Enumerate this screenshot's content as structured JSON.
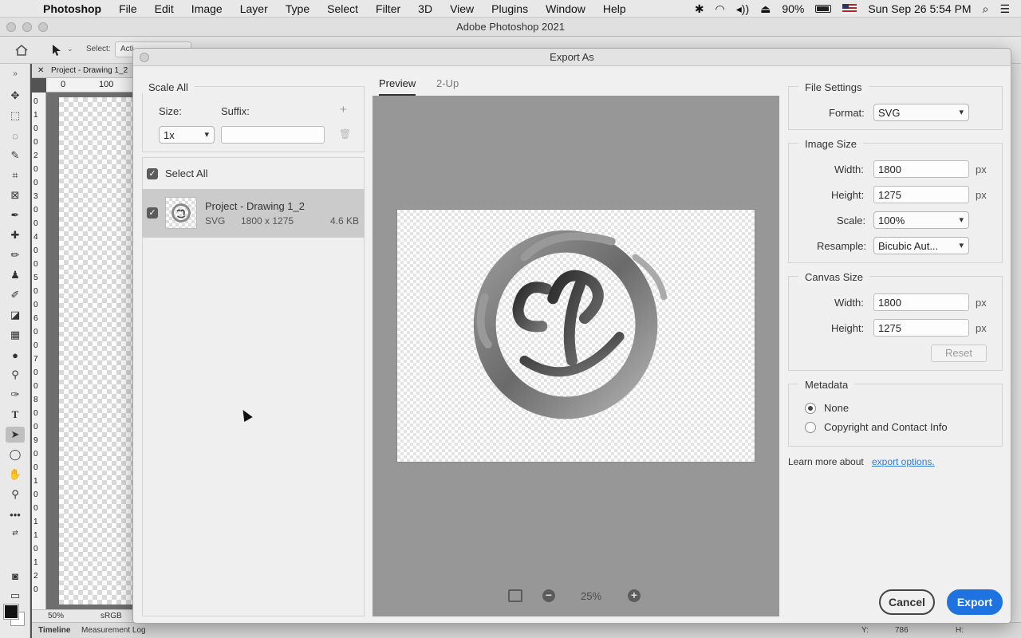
{
  "menubar": {
    "app": "Photoshop",
    "items": [
      "File",
      "Edit",
      "Image",
      "Layer",
      "Type",
      "Select",
      "Filter",
      "3D",
      "View",
      "Plugins",
      "Window",
      "Help"
    ],
    "battery": "90%",
    "datetime": "Sun Sep 26  5:54 PM"
  },
  "window": {
    "title": "Adobe Photoshop 2021"
  },
  "options": {
    "select_label": "Select:",
    "select_value": "Acti"
  },
  "document": {
    "tab_title": "Project - Drawing 1_2",
    "ruler_h": [
      "0",
      "100"
    ],
    "ruler_v": [
      "0",
      "1",
      "0",
      "0",
      "2",
      "0",
      "0",
      "3",
      "0",
      "0",
      "4",
      "0",
      "0",
      "5",
      "0",
      "0",
      "6",
      "0",
      "0",
      "7",
      "0",
      "0",
      "8",
      "0",
      "0",
      "9",
      "0",
      "0",
      "1",
      "0",
      "0",
      "1",
      "1",
      "0",
      "1",
      "2",
      "0"
    ],
    "zoom": "50%",
    "color_profile": "sRGB IEC"
  },
  "bottom_panel": {
    "tabs": [
      "Timeline",
      "Measurement Log"
    ],
    "y_label": "Y:",
    "y_value": "786",
    "h_label": "H:"
  },
  "dialog": {
    "title": "Export As",
    "scale_all": {
      "heading": "Scale All",
      "size_label": "Size:",
      "suffix_label": "Suffix:",
      "size_value": "1x",
      "suffix_value": ""
    },
    "select_all_label": "Select All",
    "asset": {
      "name": "Project - Drawing 1_2",
      "format": "SVG",
      "dimensions": "1800 x 1275",
      "size": "4.6 KB"
    },
    "preview": {
      "tab_preview": "Preview",
      "tab_2up": "2-Up",
      "zoom": "25%"
    },
    "file_settings": {
      "heading": "File Settings",
      "format_label": "Format:",
      "format_value": "SVG"
    },
    "image_size": {
      "heading": "Image Size",
      "width_label": "Width:",
      "width_value": "1800",
      "height_label": "Height:",
      "height_value": "1275",
      "scale_label": "Scale:",
      "scale_value": "100%",
      "resample_label": "Resample:",
      "resample_value": "Bicubic Aut...",
      "unit": "px"
    },
    "canvas_size": {
      "heading": "Canvas Size",
      "width_label": "Width:",
      "width_value": "1800",
      "height_label": "Height:",
      "height_value": "1275",
      "unit": "px",
      "reset_label": "Reset"
    },
    "metadata": {
      "heading": "Metadata",
      "option_none": "None",
      "option_copyright": "Copyright and Contact Info",
      "selected": "None"
    },
    "learn_more": {
      "text": "Learn more about",
      "link": "export options."
    },
    "cancel_label": "Cancel",
    "export_label": "Export"
  },
  "colors": {
    "accent": "#1f73e0",
    "link": "#2f7ad9",
    "preview_bg": "#979797"
  }
}
